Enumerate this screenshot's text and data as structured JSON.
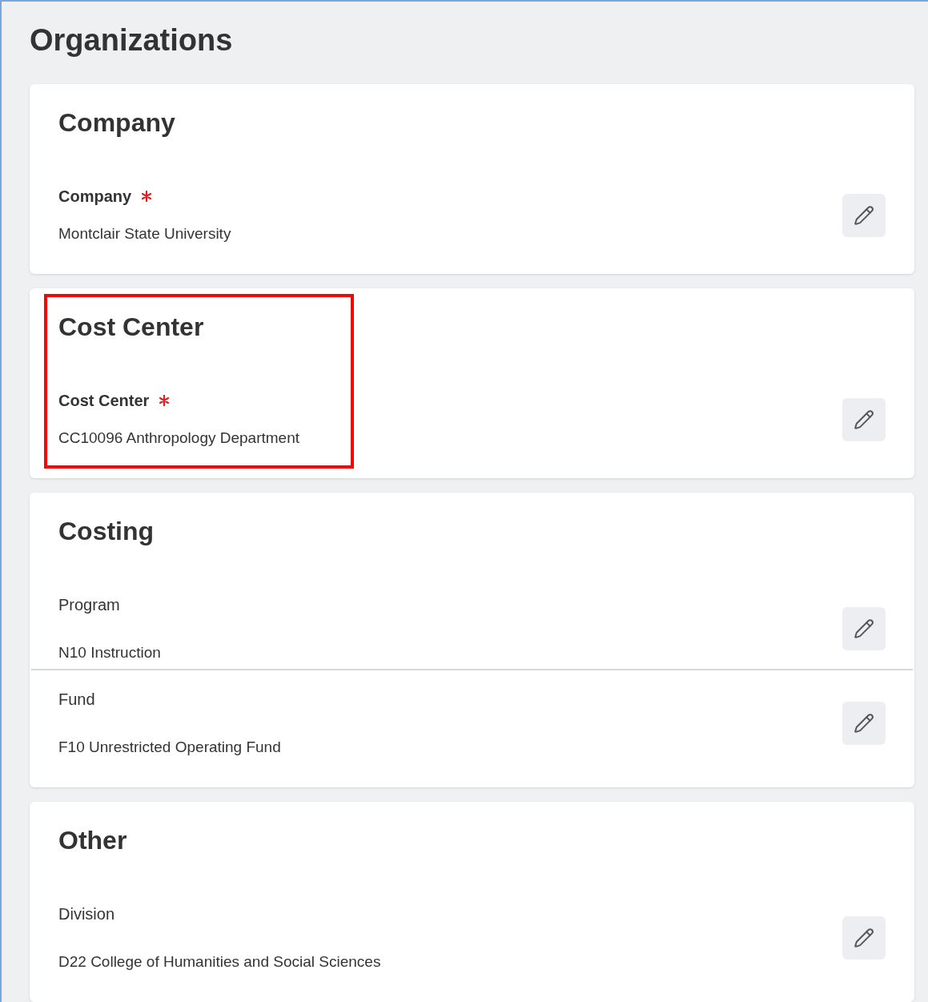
{
  "title": "Organizations",
  "sections": [
    {
      "title": "Company",
      "highlighted": false,
      "fields": [
        {
          "label": "Company",
          "required": true,
          "value": "Montclair State University"
        }
      ]
    },
    {
      "title": "Cost Center",
      "highlighted": true,
      "fields": [
        {
          "label": "Cost Center",
          "required": true,
          "value": "CC10096 Anthropology Department"
        }
      ]
    },
    {
      "title": "Costing",
      "highlighted": false,
      "fields": [
        {
          "label": "Program",
          "required": false,
          "value": "N10 Instruction"
        },
        {
          "label": "Fund",
          "required": false,
          "value": "F10 Unrestricted Operating Fund"
        }
      ]
    },
    {
      "title": "Other",
      "highlighted": false,
      "fields": [
        {
          "label": "Division",
          "required": false,
          "value": "D22 College of Humanities and Social Sciences"
        }
      ]
    }
  ]
}
